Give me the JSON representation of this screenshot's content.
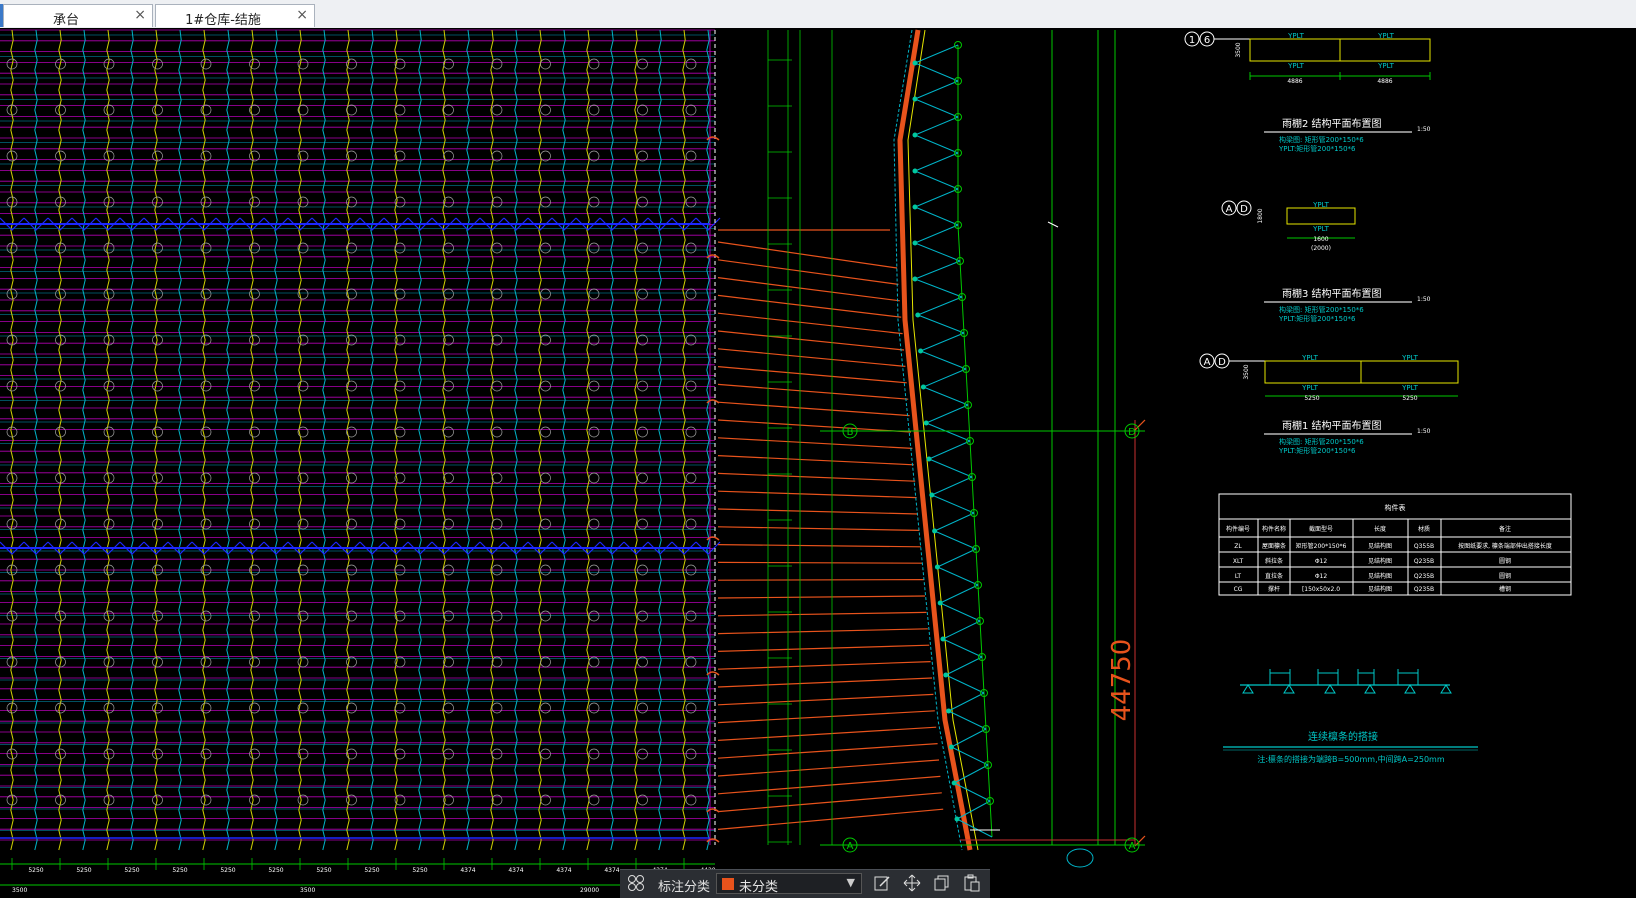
{
  "tabs": [
    {
      "label": "承台",
      "active": false
    },
    {
      "label": "1#仓库-结施",
      "active": true
    }
  ],
  "drawing": {
    "grid_labels": {
      "B_left": "B",
      "D_right": "D",
      "A_left": "A",
      "A_right": "A"
    },
    "dimension_main": "44750",
    "canopy_details": [
      {
        "axes": [
          "1",
          "6"
        ],
        "beam_label": "YPLT",
        "height_dim": "3500",
        "spans": [
          "4886",
          "4886"
        ],
        "title": "雨棚2 结构平面布置图",
        "scale": "1:50",
        "note1": "构梁图: 矩形管200*150*6",
        "note2": "YPLT:矩形管200*150*6"
      },
      {
        "axes": [
          "A",
          "D"
        ],
        "beam_label": "YPLT",
        "height_dim": "1800",
        "spans": [
          "1600"
        ],
        "sub": "(2000)",
        "title": "雨棚3 结构平面布置图",
        "scale": "1:50",
        "note1": "构梁图: 矩形管200*150*6",
        "note2": "YPLT:矩形管200*150*6"
      },
      {
        "axes": [
          "A",
          "D"
        ],
        "beam_label": "YPLT",
        "height_dim": "3500",
        "spans": [
          "5250",
          "5250"
        ],
        "title": "雨棚1 结构平面布置图",
        "scale": "1:50",
        "note1": "构梁图: 矩形管200*150*6",
        "note2": "YPLT:矩形管200*150*6"
      }
    ],
    "member_table": {
      "title": "构件表",
      "headers": [
        "构件编号",
        "构件名称",
        "截面型号",
        "长度",
        "材质",
        "备注"
      ],
      "rows": [
        [
          "ZL",
          "屋面檩条",
          "矩形管200*150*6",
          "见结构图",
          "Q355B",
          "按图纸要求, 檩条端部伸出搭接长度"
        ],
        [
          "XLT",
          "斜拉条",
          "Φ12",
          "见结构图",
          "Q235B",
          "圆钢"
        ],
        [
          "LT",
          "直拉条",
          "Φ12",
          "见结构图",
          "Q235B",
          "圆钢"
        ],
        [
          "CG",
          "撑杆",
          "[150x50x2.0",
          "见结构图",
          "Q235B",
          "槽钢"
        ]
      ]
    },
    "lap_title": "连续檩条的搭接",
    "lap_note": "注:檩条的搭接为端跨B=500mm,中间跨A=250mm",
    "bottom_dims": [
      "5250",
      "5250",
      "5250",
      "5250",
      "5250",
      "5250",
      "5250",
      "5250",
      "5250",
      "4374",
      "4374",
      "4374",
      "4374",
      "4374",
      "4420"
    ],
    "bottom_totals": [
      "3500",
      "3500",
      "29000"
    ]
  },
  "toolbar": {
    "grid_icon": "grid-icon",
    "label": "标注分类",
    "dropdown_value": "未分类",
    "dropdown_color": "#e8531c",
    "icons": [
      "edit-icon",
      "move-icon",
      "copy-icon",
      "paste-icon"
    ]
  },
  "colors": {
    "bg": "#000000",
    "grid_cyan": "#00b4c8",
    "grid_magenta": "#c800c8",
    "grid_yellow": "#e6e600",
    "green": "#00c800",
    "orange": "#e8531c",
    "white": "#ffffff",
    "blue": "#1e28ff",
    "tab_bar": "#eef0f3"
  }
}
